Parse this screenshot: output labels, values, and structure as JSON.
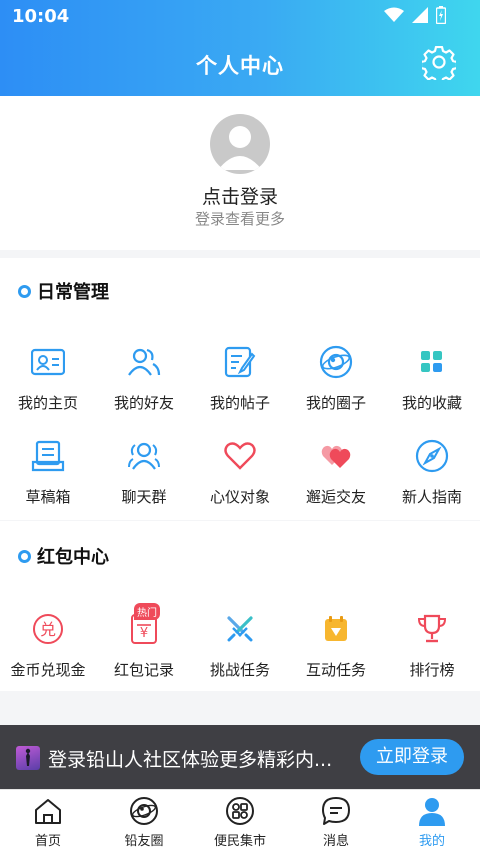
{
  "status": {
    "time": "10:04"
  },
  "header": {
    "title": "个人中心"
  },
  "profile": {
    "login_title": "点击登录",
    "login_sub": "登录查看更多"
  },
  "daily": {
    "title": "日常管理",
    "items": [
      {
        "label": "我的主页",
        "icon": "id-card-icon"
      },
      {
        "label": "我的好友",
        "icon": "friends-icon"
      },
      {
        "label": "我的帖子",
        "icon": "post-edit-icon"
      },
      {
        "label": "我的圈子",
        "icon": "circle-icon"
      },
      {
        "label": "我的收藏",
        "icon": "favorites-grid-icon"
      },
      {
        "label": "草稿箱",
        "icon": "draft-box-icon"
      },
      {
        "label": "聊天群",
        "icon": "chat-group-icon"
      },
      {
        "label": "心仪对象",
        "icon": "heart-icon"
      },
      {
        "label": "邂逅交友",
        "icon": "double-heart-icon"
      },
      {
        "label": "新人指南",
        "icon": "compass-icon"
      }
    ]
  },
  "redpacket": {
    "title": "红包中心",
    "items": [
      {
        "label": "金币兑现金",
        "icon": "coin-exchange-icon"
      },
      {
        "label": "红包记录",
        "icon": "red-packet-icon",
        "badge": "热门"
      },
      {
        "label": "挑战任务",
        "icon": "swords-icon"
      },
      {
        "label": "互动任务",
        "icon": "calendar-gem-icon"
      },
      {
        "label": "排行榜",
        "icon": "trophy-icon"
      }
    ]
  },
  "banner": {
    "text": "登录铅山人社区体验更多精彩内...",
    "button": "立即登录"
  },
  "tabbar": {
    "items": [
      {
        "label": "首页",
        "icon": "home-icon"
      },
      {
        "label": "铅友圈",
        "icon": "planet-icon"
      },
      {
        "label": "便民集市",
        "icon": "market-icon"
      },
      {
        "label": "消息",
        "icon": "message-icon"
      },
      {
        "label": "我的",
        "icon": "profile-icon",
        "active": true
      }
    ]
  },
  "colors": {
    "accent": "#2e9bf0",
    "red": "#ef4a5a",
    "banner_bg": "#3f3f44"
  }
}
